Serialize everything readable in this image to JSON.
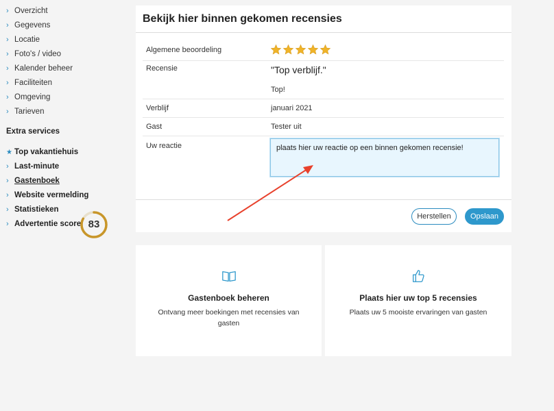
{
  "sidebar": {
    "items": [
      {
        "label": "Overzicht"
      },
      {
        "label": "Gegevens"
      },
      {
        "label": "Locatie"
      },
      {
        "label": "Foto's / video"
      },
      {
        "label": "Kalender beheer"
      },
      {
        "label": "Faciliteiten"
      },
      {
        "label": "Omgeving"
      },
      {
        "label": "Tarieven"
      }
    ],
    "extra_title": "Extra services",
    "extra_items": [
      {
        "label": "Top vakantiehuis"
      },
      {
        "label": "Last-minute"
      },
      {
        "label": "Gastenboek"
      },
      {
        "label": "Website vermelding"
      },
      {
        "label": "Statistieken"
      },
      {
        "label": "Advertentie score"
      }
    ],
    "score": "83",
    "score_fraction": 0.83,
    "score_color": "#c8962a"
  },
  "review": {
    "title": "Bekijk hier binnen gekomen recensies",
    "rating_label": "Algemene beoordeling",
    "rating_stars": 5,
    "review_label": "Recensie",
    "review_title": "\"Top verblijf.\"",
    "review_text": "Top!",
    "stay_label": "Verblijf",
    "stay_value": "januari 2021",
    "guest_label": "Gast",
    "guest_value": "Tester uit",
    "reply_label": "Uw reactie",
    "reply_placeholder": "plaats hier uw reactie op een binnen gekomen recensie!",
    "reset_label": "Herstellen",
    "save_label": "Opslaan"
  },
  "tiles": [
    {
      "icon": "book-icon",
      "title": "Gastenboek beheren",
      "desc": "Ontvang meer boekingen met recensies van gasten"
    },
    {
      "icon": "thumbs-up-icon",
      "title": "Plaats hier uw top 5 recensies",
      "desc": "Plaats uw 5 mooiste ervaringen van gasten"
    }
  ],
  "colors": {
    "accent": "#2e98cc",
    "star": "#f0b429",
    "annotation_arrow": "#e8412c"
  }
}
